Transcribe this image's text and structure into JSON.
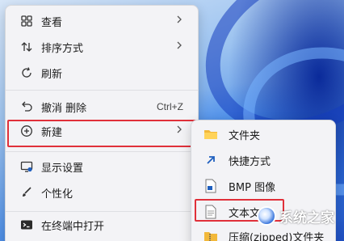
{
  "context_menu": {
    "items": [
      {
        "label": "查看",
        "icon": "grid-icon"
      },
      {
        "label": "排序方式",
        "icon": "sort-icon"
      },
      {
        "label": "刷新",
        "icon": "refresh-icon"
      },
      {
        "label": "撤消 删除",
        "icon": "undo-icon",
        "shortcut": "Ctrl+Z"
      },
      {
        "label": "新建",
        "icon": "plus-circle-icon"
      },
      {
        "label": "显示设置",
        "icon": "display-settings-icon"
      },
      {
        "label": "个性化",
        "icon": "brush-icon"
      },
      {
        "label": "在终端中打开",
        "icon": "terminal-icon"
      }
    ]
  },
  "new_submenu": {
    "items": [
      {
        "label": "文件夹",
        "icon": "folder-icon"
      },
      {
        "label": "快捷方式",
        "icon": "shortcut-icon"
      },
      {
        "label": "BMP 图像",
        "icon": "bmp-image-icon"
      },
      {
        "label": "文本文档",
        "icon": "text-document-icon"
      },
      {
        "label": "压缩(zipped)文件夹",
        "icon": "zip-folder-icon"
      }
    ]
  },
  "watermark": {
    "text": "系统之家"
  },
  "colors": {
    "highlight_border": "#e0303a",
    "menu_bg": "#f3f3f6",
    "folder": "#f2b83a",
    "accent_blue": "#1f5fbf"
  }
}
